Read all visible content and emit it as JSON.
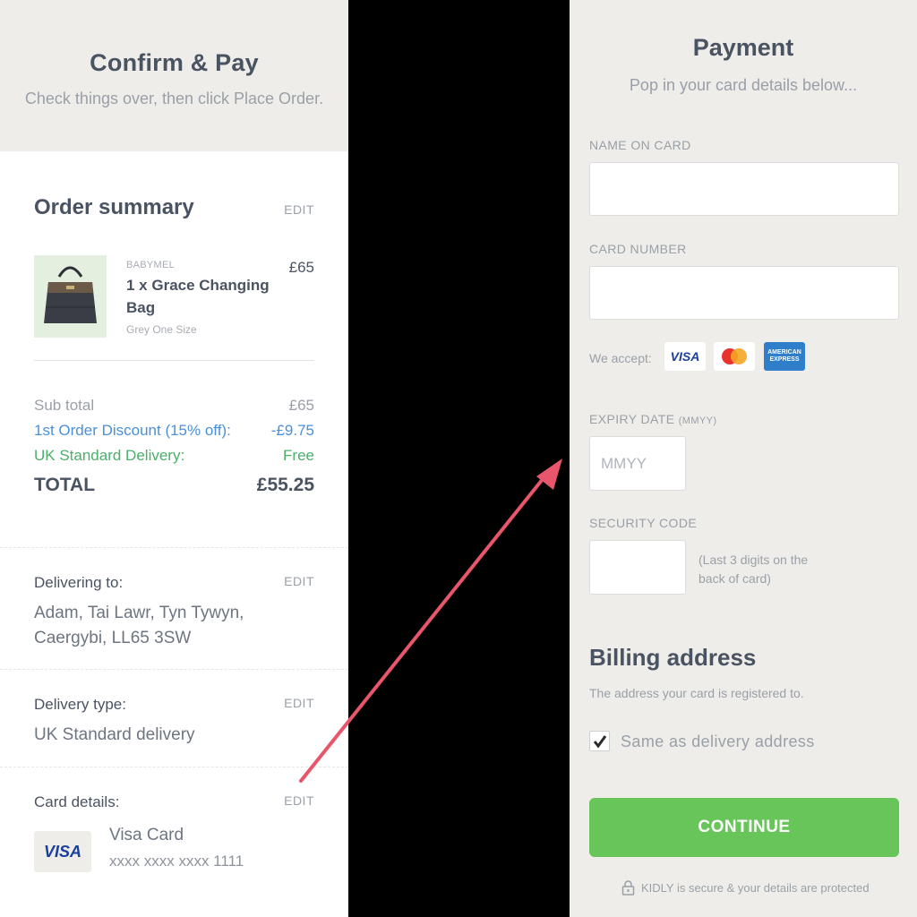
{
  "confirm": {
    "title": "Confirm & Pay",
    "subtitle": "Check things over, then click Place Order."
  },
  "order_summary": {
    "title": "Order summary",
    "edit_label": "EDIT",
    "item": {
      "brand": "BABYMEL",
      "name": "1 x Grace Changing Bag",
      "variant": "Grey One Size",
      "price": "£65"
    },
    "totals": {
      "subtotal_label": "Sub total",
      "subtotal_value": "£65",
      "discount_label": "1st Order Discount (15% off):",
      "discount_value": "-£9.75",
      "delivery_label": "UK Standard Delivery:",
      "delivery_value": "Free",
      "total_label": "TOTAL",
      "total_value": "£55.25"
    }
  },
  "delivering_to": {
    "label": "Delivering to:",
    "edit_label": "EDIT",
    "line1": "Adam, Tai Lawr, Tyn Tywyn,",
    "line2": "Caergybi, LL65 3SW"
  },
  "delivery_type": {
    "label": "Delivery type:",
    "edit_label": "EDIT",
    "value": "UK Standard delivery"
  },
  "card_details": {
    "label": "Card details:",
    "edit_label": "EDIT",
    "badge": "VISA",
    "card_name": "Visa Card",
    "card_number": "xxxx xxxx xxxx 1111"
  },
  "payment": {
    "title": "Payment",
    "subtitle": "Pop in your card details below...",
    "name_label": "NAME ON CARD",
    "name_value": "",
    "number_label": "CARD NUMBER",
    "number_value": "",
    "accept_label": "We accept:",
    "accepted_cards": [
      {
        "name": "VISA",
        "icon": "visa-logo-icon"
      },
      {
        "name": "MasterCard",
        "icon": "mastercard-logo-icon"
      },
      {
        "name": "AMERICAN EXPRESS",
        "icon": "amex-logo-icon"
      }
    ],
    "expiry_label": "EXPIRY DATE",
    "expiry_format": "(MMYY)",
    "expiry_placeholder": "MMYY",
    "security_label": "SECURITY CODE",
    "security_hint": "(Last 3 digits on the back of card)"
  },
  "billing": {
    "title": "Billing address",
    "subtitle": "The address your card is registered to.",
    "same_as_delivery_label": "Same as delivery address",
    "same_as_delivery_checked": true
  },
  "continue_label": "CONTINUE",
  "secure_note": "KIDLY is secure & your details are protected",
  "colors": {
    "accent_green": "#67c55a",
    "discount_blue": "#4a90d9",
    "delivery_green": "#4caf6a",
    "arrow": "#e8566c"
  }
}
